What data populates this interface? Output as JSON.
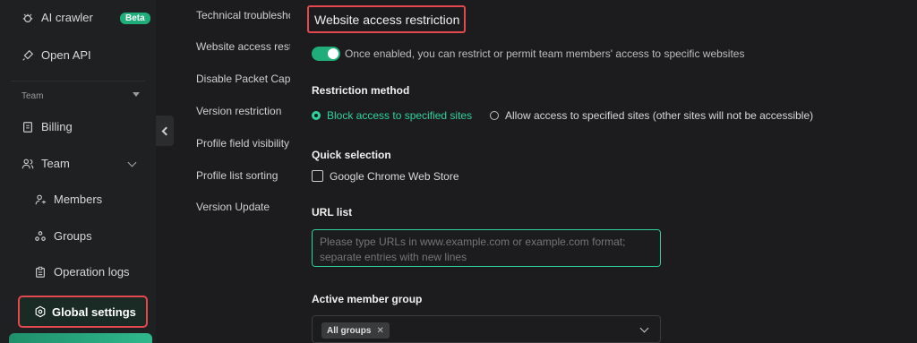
{
  "sidebar": {
    "ai_crawler": "AI crawler",
    "beta": "Beta",
    "open_api": "Open API",
    "team_section": "Team",
    "billing": "Billing",
    "team": "Team",
    "members": "Members",
    "groups": "Groups",
    "operation_logs": "Operation logs",
    "global_settings": "Global settings"
  },
  "subnav": {
    "items": [
      "Technical troubleshooting",
      "Website access restriction",
      "Disable Packet Capture",
      "Version restriction",
      "Profile field visibility",
      "Profile list sorting",
      "Version Update"
    ]
  },
  "main": {
    "title": "Website access restriction",
    "toggle_on": true,
    "toggle_desc": "Once enabled, you can restrict or permit team members' access to specific websites",
    "restriction_method_label": "Restriction method",
    "option_block": "Block access to specified sites",
    "option_allow": "Allow access to specified sites (other sites will not be accessible)",
    "quick_selection_label": "Quick selection",
    "quick_option": "Google Chrome Web Store",
    "url_list_label": "URL list",
    "url_placeholder": "Please type URLs in www.example.com or example.com format; separate entries with new lines",
    "active_group_label": "Active member group",
    "group_tag": "All groups"
  },
  "colors": {
    "accent": "#2fd39a",
    "toggle": "#1fae7a",
    "highlight_border": "#e4484f"
  }
}
